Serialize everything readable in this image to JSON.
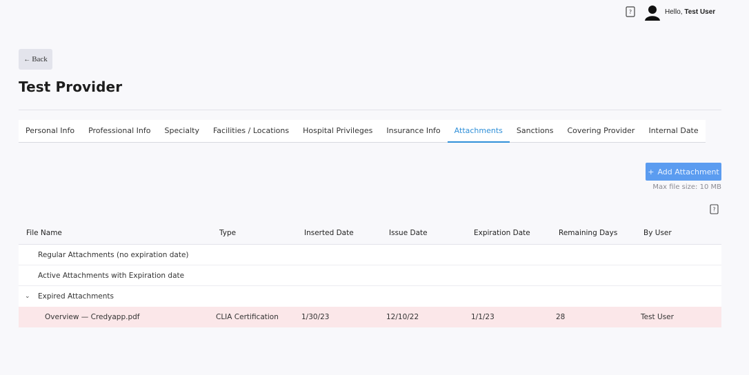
{
  "header": {
    "greeting_prefix": "Hello, ",
    "user_name": "Test User"
  },
  "back_label": "Back",
  "page_title": "Test Provider",
  "tabs": [
    {
      "label": "Personal Info"
    },
    {
      "label": "Professional Info"
    },
    {
      "label": "Specialty"
    },
    {
      "label": "Facilities / Locations"
    },
    {
      "label": "Hospital Privileges"
    },
    {
      "label": "Insurance Info"
    },
    {
      "label": "Attachments",
      "active": true
    },
    {
      "label": "Sanctions"
    },
    {
      "label": "Covering Provider"
    },
    {
      "label": "Internal Date"
    }
  ],
  "add_attachment_label": "Add Attachment",
  "max_file_size": "Max file size: 10 MB",
  "table": {
    "columns": [
      "File Name",
      "Type",
      "Inserted Date",
      "Issue Date",
      "Expiration Date",
      "Remaining Days",
      "By User"
    ],
    "groups": [
      {
        "label": "Regular Attachments (no expiration date)"
      },
      {
        "label": "Active Attachments with Expiration date"
      },
      {
        "label": "Expired Attachments",
        "expanded": true
      }
    ],
    "rows": [
      {
        "file_name": "Overview — Credyapp.pdf",
        "type": "CLIA Certification",
        "inserted_date": "1/30/23",
        "issue_date": "12/10/22",
        "expiration_date": "1/1/23",
        "remaining_days": "28",
        "by_user": "Test User"
      }
    ]
  },
  "colors": {
    "accent": "#2f8fd8",
    "button": "#5b9cf0",
    "expired_row": "#fbe7e9",
    "background": "#f8f8fb"
  }
}
